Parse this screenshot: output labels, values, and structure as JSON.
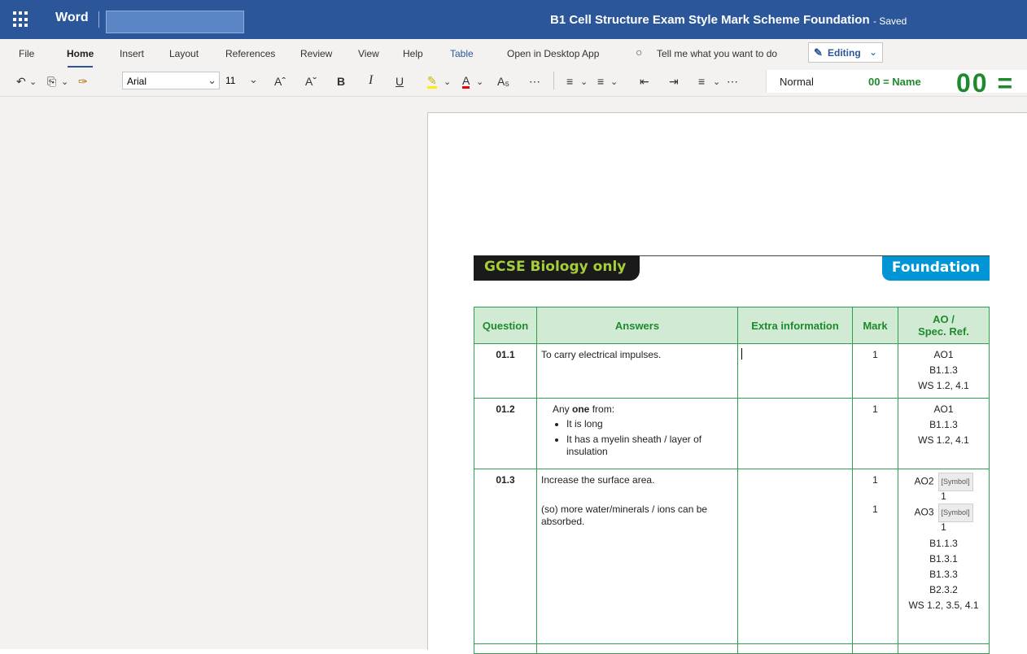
{
  "titlebar": {
    "app_name": "Word",
    "doc_title": "B1 Cell Structure Exam Style Mark Scheme Foundation",
    "save_status": "-  Saved"
  },
  "menu": {
    "file": "File",
    "home": "Home",
    "insert": "Insert",
    "layout": "Layout",
    "references": "References",
    "review": "Review",
    "view": "View",
    "help": "Help",
    "table": "Table",
    "open_desktop": "Open in Desktop App",
    "tell_me": "Tell me what you want to do",
    "editing": "Editing"
  },
  "ribbon": {
    "font_name": "Arial",
    "font_size": "11",
    "style_normal": "Normal",
    "style_heading": "00 = Name",
    "style_big": "00 ="
  },
  "document": {
    "tag_left": "GCSE Biology only",
    "tag_right": "Foundation",
    "headers": {
      "question": "Question",
      "answers": "Answers",
      "extra": "Extra information",
      "mark": "Mark",
      "ao_line1": "AO /",
      "ao_line2": "Spec. Ref."
    },
    "rows": [
      {
        "q": "01.1",
        "answer": "To carry electrical impulses.",
        "mark": "1",
        "ao": [
          "AO1",
          "B1.1.3",
          "WS 1.2, 4.1"
        ]
      },
      {
        "q": "01.2",
        "answer_prefix": "Any ",
        "answer_bold": "one",
        "answer_suffix": " from:",
        "bullets": [
          "It is long",
          "It has a myelin sheath / layer of insulation"
        ],
        "mark": "1",
        "ao": [
          "AO1",
          "B1.1.3",
          "WS 1.2, 4.1"
        ]
      },
      {
        "q": "01.3",
        "answer1": "Increase the surface area.",
        "answer2": "(so) more water/minerals / ions can be absorbed.",
        "mark1": "1",
        "mark2": "1",
        "ao_a": "AO2",
        "ao_b": "AO3",
        "symbol": "[Symbol]",
        "sym_num": "1",
        "ao_rest": [
          "B1.1.3",
          "B1.3.1",
          "B1.3.3",
          "B2.3.2",
          "WS 1.2, 3.5, 4.1"
        ]
      }
    ]
  }
}
